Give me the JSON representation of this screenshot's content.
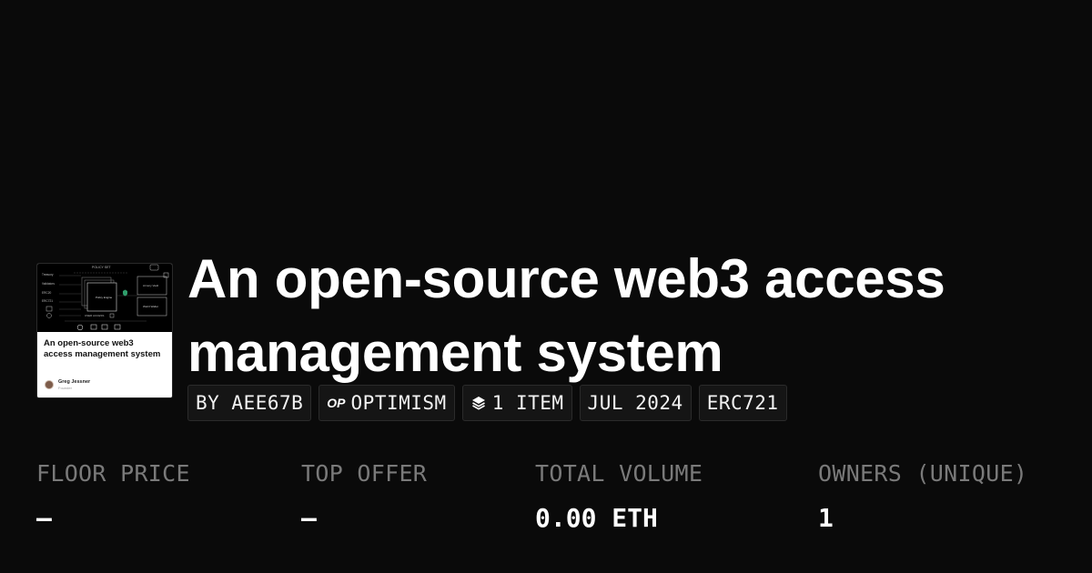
{
  "thumbnail": {
    "diagram_labels": {
      "policy": "POLICY SET",
      "row1": "Treasury",
      "row2": "Validators",
      "row3": "ERC20",
      "row4": "ERC721",
      "core": "Policy Engine",
      "side_top": "Armory Vault",
      "side_bottom": "Web3 Wallet",
      "footer": "USER ACCESS"
    },
    "title": "An open-source web3 access management system",
    "author_name": "Greg Jessner",
    "author_sub": "Founder"
  },
  "collection": {
    "title": "An open-source web3 access management system"
  },
  "tags": {
    "creator": "BY AEE67B",
    "chain_logo": "OP",
    "chain": "OPTIMISM",
    "items": "1 ITEM",
    "date": "JUL 2024",
    "standard": "ERC721"
  },
  "icons": {
    "chain": "optimism-logo-icon",
    "items": "layers-icon"
  },
  "stats": [
    {
      "label": "FLOOR PRICE",
      "value": "—"
    },
    {
      "label": "TOP OFFER",
      "value": "—"
    },
    {
      "label": "TOTAL VOLUME",
      "value": "0.00 ETH"
    },
    {
      "label": "OWNERS (UNIQUE)",
      "value": "1"
    }
  ],
  "colors": {
    "background": "#0a0a0a",
    "text": "#ffffff",
    "muted": "#7a7a7a",
    "tag_bg": "#151515"
  }
}
